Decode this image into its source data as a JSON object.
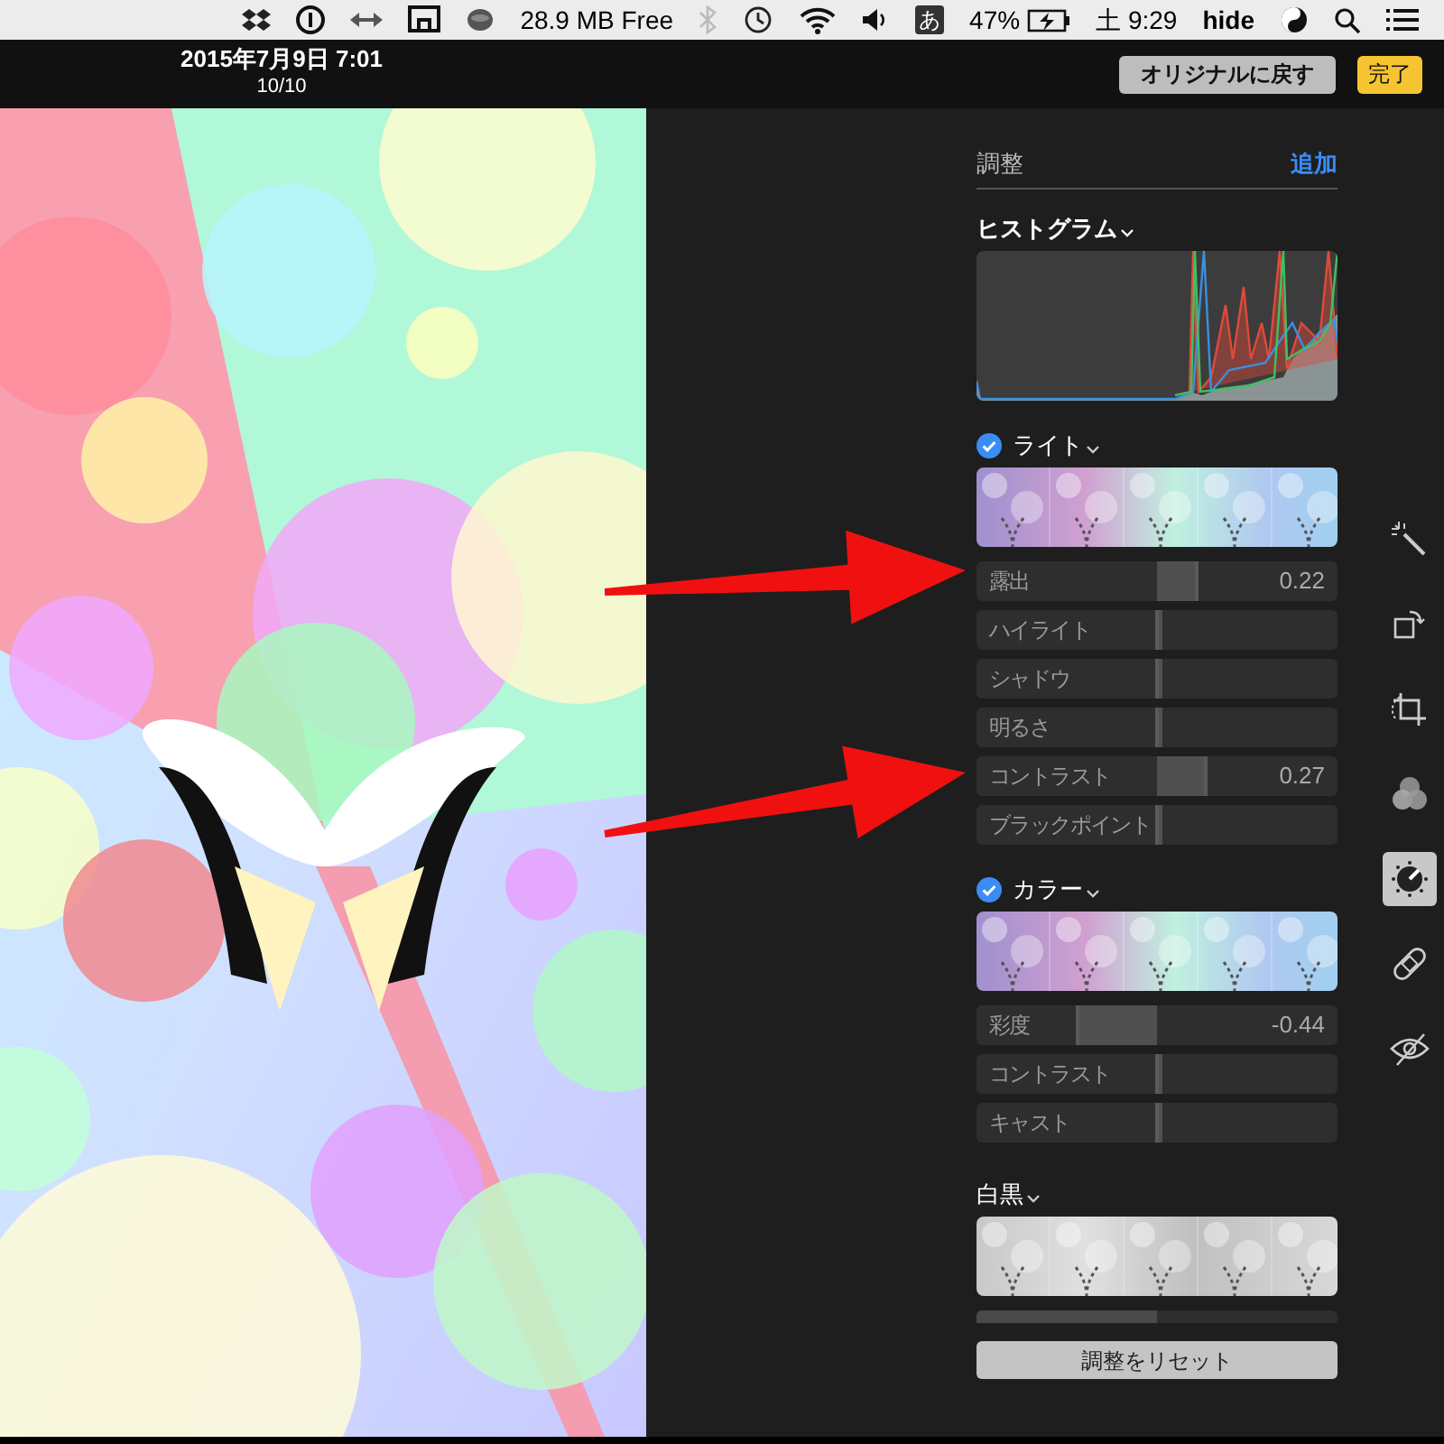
{
  "menu_bar": {
    "memory": "28.9 MB Free",
    "input_method": "あ",
    "battery": "47%",
    "clock": "土 9:29",
    "user": "hide"
  },
  "toolbar": {
    "date": "2015年7月9日 7:01",
    "counter": "10/10",
    "revert_button": "オリジナルに戻す",
    "done_button": "完了"
  },
  "panel": {
    "title": "調整",
    "add_button": "追加",
    "histogram_title": "ヒストグラム",
    "sections": [
      {
        "kind": "sliders",
        "title": "ライト",
        "checked": true,
        "sliders": [
          {
            "label": "露出",
            "level": 0.61,
            "reading": "0.22"
          },
          {
            "label": "ハイライト",
            "level": 0.5
          },
          {
            "label": "シャドウ",
            "level": 0.5
          },
          {
            "label": "明るさ",
            "level": 0.5
          },
          {
            "label": "コントラスト",
            "level": 0.635,
            "reading": "0.27"
          },
          {
            "label": "ブラックポイント",
            "level": 0.5
          }
        ]
      },
      {
        "kind": "sliders",
        "title": "カラー",
        "checked": true,
        "sliders": [
          {
            "label": "彩度",
            "level": 0.28,
            "reading": "-0.44"
          },
          {
            "label": "コントラスト",
            "level": 0.5
          },
          {
            "label": "キャスト",
            "level": 0.5
          }
        ]
      },
      {
        "kind": "cut",
        "title": "白黒",
        "checked": false,
        "sliders": [
          {
            "level": 0.5
          }
        ]
      }
    ],
    "reset_button": "調整をリセット"
  },
  "tools": [
    {
      "selected": false
    },
    {
      "selected": false
    },
    {
      "selected": false
    },
    {
      "selected": false
    },
    {
      "selected": true
    },
    {
      "selected": false
    },
    {
      "selected": false
    }
  ]
}
